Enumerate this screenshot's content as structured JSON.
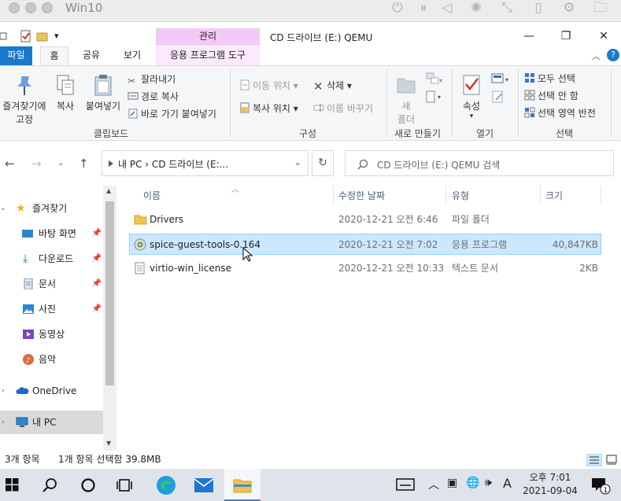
{
  "vm": {
    "title": "Win10"
  },
  "window": {
    "title": "CD 드라이브 (E:) QEMU",
    "context_tab": "관리",
    "minimize": "—",
    "maximize": "❐",
    "close": "✕"
  },
  "ribbon_tabs": [
    "파일",
    "홈",
    "공유",
    "보기",
    "응용 프로그램 도구"
  ],
  "ribbon": {
    "clipboard": {
      "pin_label_1": "즐겨찾기에",
      "pin_label_2": "고정",
      "copy": "복사",
      "paste": "붙여넣기",
      "cut": "잘라내기",
      "copy_path": "경로 복사",
      "paste_shortcut": "바로 가기 붙여넣기",
      "group": "클립보드"
    },
    "organize": {
      "move_to": "이동 위치",
      "copy_to": "복사 위치",
      "delete": "삭제",
      "rename": "이름 바꾸기",
      "group": "구성"
    },
    "new": {
      "new_folder_1": "새",
      "new_folder_2": "폴더",
      "group": "새로 만들기"
    },
    "open": {
      "properties": "속성",
      "group": "열기"
    },
    "select": {
      "select_all": "모두 선택",
      "select_none": "선택 안 함",
      "invert": "선택 영역 반전",
      "group": "선택"
    }
  },
  "address": {
    "path": "내 PC  ›  CD 드라이브 (E:...",
    "search_placeholder": "CD 드라이브 (E:) QEMU 검색"
  },
  "nav": {
    "quick_access": "즐겨찾기",
    "items": [
      {
        "label": "바탕 화면",
        "pinned": true
      },
      {
        "label": "다운로드",
        "pinned": true
      },
      {
        "label": "문서",
        "pinned": true
      },
      {
        "label": "사진",
        "pinned": true
      },
      {
        "label": "동영상",
        "pinned": false
      },
      {
        "label": "음악",
        "pinned": false
      }
    ],
    "onedrive": "OneDrive",
    "this_pc": "내 PC"
  },
  "columns": {
    "name": "이름",
    "modified": "수정한 날짜",
    "type": "유형",
    "size": "크기"
  },
  "files": [
    {
      "name": "Drivers",
      "modified": "2020-12-21 오전 6:46",
      "type": "파일 폴더",
      "size": "",
      "icon": "folder-icon"
    },
    {
      "name": "spice-guest-tools-0.164",
      "modified": "2020-12-21 오전 7:02",
      "type": "응용 프로그램",
      "size": "40,847KB",
      "icon": "installer-icon",
      "selected": true
    },
    {
      "name": "virtio-win_license",
      "modified": "2020-12-21 오전 10:33",
      "type": "텍스트 문서",
      "size": "2KB",
      "icon": "text-file-icon"
    }
  ],
  "status": {
    "count": "3개 항목",
    "selection": "1개 항목 선택함 39.8MB"
  },
  "taskbar": {
    "time": "오후 7:01",
    "date": "2021-09-04",
    "ime": "A"
  },
  "colors": {
    "accent": "#1979ca",
    "context_tab": "#f4c9f8",
    "selection": "#cce8ff",
    "taskbar": "#dfe4eb"
  }
}
